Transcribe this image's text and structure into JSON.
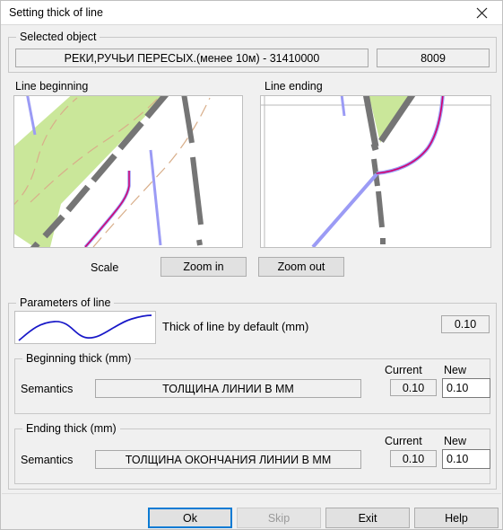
{
  "window": {
    "title": "Setting thick of line",
    "close_icon": "close-icon"
  },
  "selected_object": {
    "group_label": "Selected object",
    "name_value": "РЕКИ,РУЧЬИ ПЕРЕСЫХ.(менее 10м) - 31410000",
    "code_value": "8009"
  },
  "preview": {
    "beginning_label": "Line beginning",
    "ending_label": "Line ending",
    "scale_label": "Scale",
    "zoom_in_label": "Zoom in",
    "zoom_out_label": "Zoom out"
  },
  "parameters": {
    "group_label": "Parameters of line",
    "default_thick_label": "Thick of line by default (mm)",
    "default_thick_value": "0.10",
    "line_sample_icon": "line-curve-preview"
  },
  "beginning_thick": {
    "group_label": "Beginning thick (mm)",
    "semantics_label": "Semantics",
    "semantics_value": "ТОЛЩИНА ЛИНИИ В ММ",
    "current_label": "Current",
    "new_label": "New",
    "current_value": "0.10",
    "new_value": "0.10"
  },
  "ending_thick": {
    "group_label": "Ending thick (mm)",
    "semantics_label": "Semantics",
    "semantics_value": "ТОЛЩИНА ОКОНЧАНИЯ ЛИНИИ В ММ",
    "current_label": "Current",
    "new_label": "New",
    "current_value": "0.10",
    "new_value": "0.10"
  },
  "footer": {
    "ok_label": "Ok",
    "skip_label": "Skip",
    "exit_label": "Exit",
    "help_label": "Help"
  },
  "colors": {
    "accent": "#0b7bd4",
    "dialog_bg": "#f0f0f0",
    "titlebar_bg": "#ffffff",
    "map_vegetation": "#cae79a",
    "map_road": "#757575",
    "map_river_blue": "#9b9bf5",
    "map_selected_line": "#d4006e",
    "map_trail": "#d8ae8a",
    "sample_line": "#1818c8",
    "disabled_text": "#9a9a9a"
  }
}
